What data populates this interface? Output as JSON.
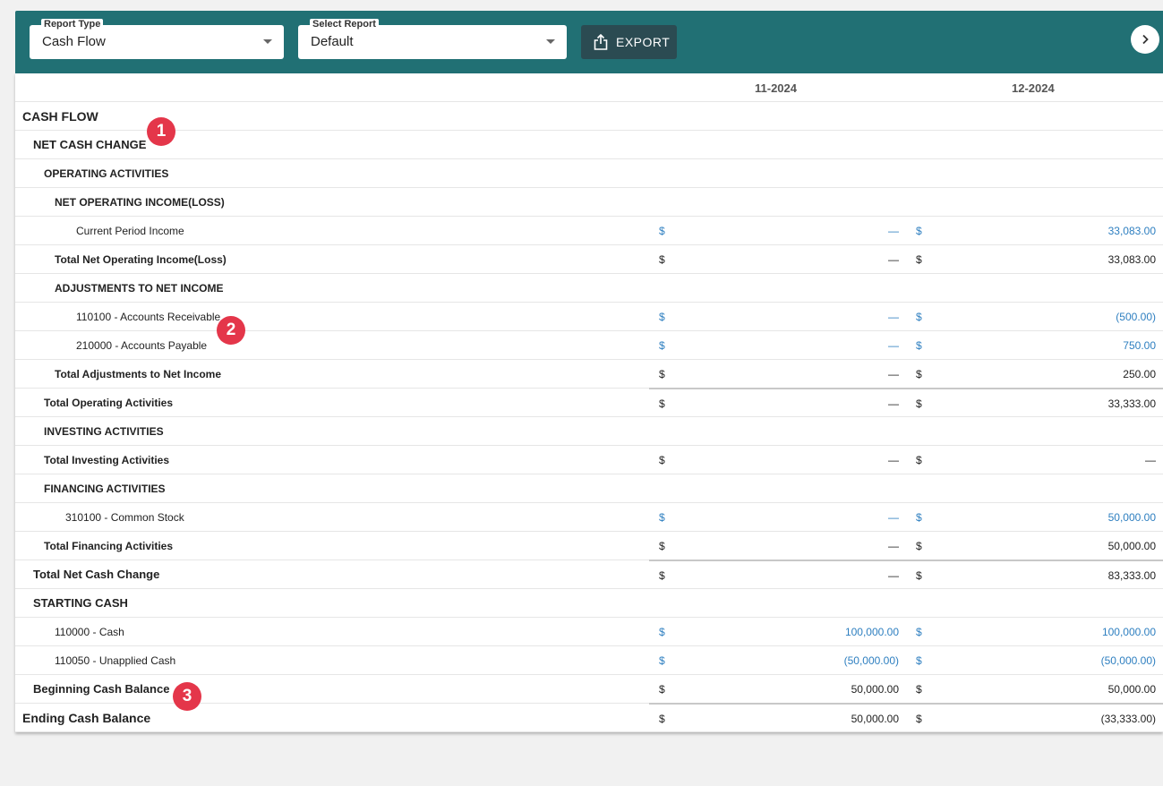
{
  "toolbar": {
    "report_type": {
      "label": "Report Type",
      "value": "Cash Flow"
    },
    "select_report": {
      "label": "Select Report",
      "value": "Default"
    },
    "export_label": "EXPORT"
  },
  "columns": [
    "11-2024",
    "12-2024"
  ],
  "rows": [
    {
      "label": "CASH FLOW",
      "style": "xl-bold",
      "indent": 0
    },
    {
      "label": "NET CASH CHANGE",
      "style": "big-bold",
      "indent": 1
    },
    {
      "label": "OPERATING ACTIVITIES",
      "style": "bold",
      "indent": 2
    },
    {
      "label": "NET OPERATING INCOME(LOSS)",
      "style": "bold",
      "indent": 3
    },
    {
      "label": "Current Period Income",
      "style": "normal",
      "indent": 5,
      "link": true,
      "values": [
        "—",
        "33,083.00"
      ]
    },
    {
      "label": "Total Net Operating Income(Loss)",
      "style": "bold",
      "indent": 3,
      "values": [
        "—",
        "33,083.00"
      ]
    },
    {
      "label": "ADJUSTMENTS TO NET INCOME",
      "style": "bold",
      "indent": 3
    },
    {
      "label": "110100 - Accounts Receivable",
      "style": "normal",
      "indent": 5,
      "link": true,
      "values": [
        "—",
        "(500.00)"
      ]
    },
    {
      "label": "210000 - Accounts Payable",
      "style": "normal",
      "indent": 5,
      "link": true,
      "values": [
        "—",
        "750.00"
      ]
    },
    {
      "label": "Total Adjustments to Net Income",
      "style": "bold",
      "indent": 3,
      "values": [
        "—",
        "250.00"
      ]
    },
    {
      "label": "Total Operating Activities",
      "style": "bold",
      "indent": 2,
      "values": [
        "—",
        "33,333.00"
      ],
      "rule": true
    },
    {
      "label": "INVESTING ACTIVITIES",
      "style": "bold",
      "indent": 2
    },
    {
      "label": "Total Investing Activities",
      "style": "bold",
      "indent": 2,
      "values": [
        "—",
        "—"
      ]
    },
    {
      "label": "FINANCING ACTIVITIES",
      "style": "bold",
      "indent": 2
    },
    {
      "label": "310100 - Common Stock",
      "style": "normal",
      "indent": 4,
      "link": true,
      "values": [
        "—",
        "50,000.00"
      ]
    },
    {
      "label": "Total Financing Activities",
      "style": "bold",
      "indent": 2,
      "values": [
        "—",
        "50,000.00"
      ]
    },
    {
      "label": "Total Net Cash Change",
      "style": "big-bold",
      "indent": 1,
      "values": [
        "—",
        "83,333.00"
      ],
      "rule": true
    },
    {
      "label": "STARTING CASH",
      "style": "big-bold",
      "indent": 1
    },
    {
      "label": "110000 - Cash",
      "style": "normal",
      "indent": 3,
      "link": true,
      "values": [
        "100,000.00",
        "100,000.00"
      ]
    },
    {
      "label": "110050 - Unapplied Cash",
      "style": "normal",
      "indent": 3,
      "link": true,
      "values": [
        "(50,000.00)",
        "(50,000.00)"
      ]
    },
    {
      "label": "Beginning Cash Balance",
      "style": "big-bold",
      "indent": 1,
      "values": [
        "50,000.00",
        "50,000.00"
      ]
    },
    {
      "label": "Ending Cash Balance",
      "style": "xl-bold",
      "indent": 0,
      "values": [
        "50,000.00",
        "(33,333.00)"
      ],
      "rule": true
    }
  ],
  "currency_symbol": "$",
  "badges": [
    "1",
    "2",
    "3"
  ],
  "colors": {
    "toolbar": "#217074",
    "export": "#2b4b52",
    "link": "#2e7fc0",
    "badge": "#e4364a"
  }
}
